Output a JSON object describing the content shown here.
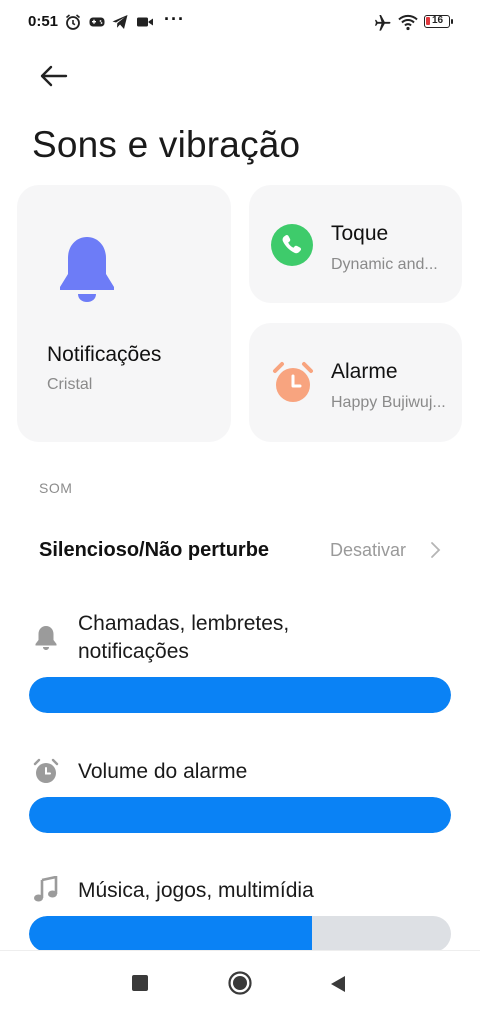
{
  "status_bar": {
    "time": "0:51",
    "more": "···",
    "battery_level": "16"
  },
  "header": {
    "title": "Sons e vibração"
  },
  "cards": {
    "notifications": {
      "title": "Notificações",
      "subtitle": "Cristal"
    },
    "ringtone": {
      "title": "Toque",
      "subtitle": "Dynamic and..."
    },
    "alarm": {
      "title": "Alarme",
      "subtitle": "Happy Bujiwuj..."
    }
  },
  "sound_section": {
    "header": "SOM",
    "dnd": {
      "label": "Silencioso/Não perturbe",
      "value": "Desativar"
    },
    "volumes": [
      {
        "label_line1": "Chamadas, lembretes,",
        "label_line2": "notificações",
        "level_pct": 100
      },
      {
        "label_line1": "Volume do alarme",
        "label_line2": "",
        "level_pct": 100
      },
      {
        "label_line1": "Música, jogos, multimídia",
        "label_line2": "",
        "level_pct": 67
      }
    ]
  },
  "colors": {
    "accent": "#0a82f5",
    "bell": "#6d7cf7",
    "phone": "#3ecb6b",
    "alarm": "#f8a47f"
  }
}
